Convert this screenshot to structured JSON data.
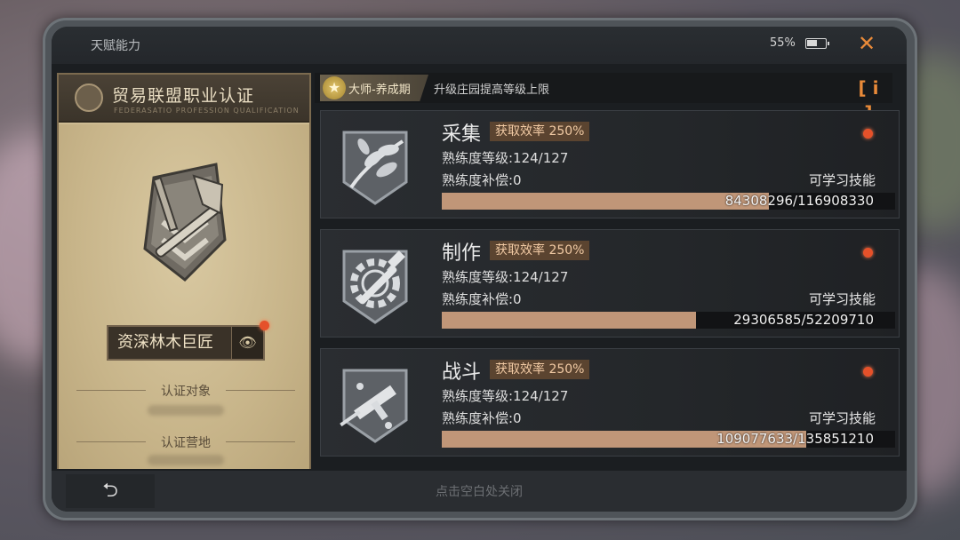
{
  "window": {
    "title": "天赋能力",
    "battery_text": "55%"
  },
  "certification": {
    "title_cn": "贸易联盟职业认证",
    "title_en": "FEDERASATIO PROFESSION QUALIFICATION",
    "rank": "资深林木巨匠",
    "target_label": "认证对象",
    "camp_label": "认证营地"
  },
  "header": {
    "master_badge": "大师-养成期",
    "upgrade_text": "升级庄园提高等级上限",
    "info_label": "[ i ]"
  },
  "skills": [
    {
      "name": "采集",
      "efficiency": "获取效率 250%",
      "level_text": "熟练度等级:124/127",
      "comp_text": "熟练度补偿:0",
      "learn_label": "可学习技能",
      "progress_text": "84308296/116908330",
      "progress": 0.721,
      "icon": "leaves-icon"
    },
    {
      "name": "制作",
      "efficiency": "获取效率 250%",
      "level_text": "熟练度等级:124/127",
      "comp_text": "熟练度补偿:0",
      "learn_label": "可学习技能",
      "progress_text": "29306585/52209710",
      "progress": 0.561,
      "icon": "gear-hammer-icon"
    },
    {
      "name": "战斗",
      "efficiency": "获取效率 250%",
      "level_text": "熟练度等级:124/127",
      "comp_text": "熟练度补偿:0",
      "learn_label": "可学习技能",
      "progress_text": "109077633/135851210",
      "progress": 0.803,
      "icon": "gun-icon"
    }
  ],
  "footer": {
    "close_hint": "点击空白处关闭",
    "back_icon": "back-arrow-icon"
  },
  "colors": {
    "accent": "#e98a39",
    "progress": "#c09678",
    "notify_dot": "#e5512a"
  }
}
